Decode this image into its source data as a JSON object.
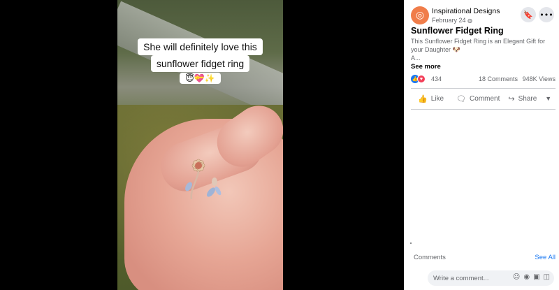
{
  "video": {
    "caption_line1": "She will definitely love this",
    "caption_line2": "sunflower fidget ring",
    "caption_emoji": "😇💝✨"
  },
  "post": {
    "page_name": "Inspirational Designs",
    "date": "February 24",
    "privacy_icon": "globe-icon",
    "title": "Sunflower Fidget Ring",
    "description": "This Sunflower Fidget Ring is an Elegant Gift for your Daughter 🐶",
    "description_tail": "A...",
    "see_more": "See more",
    "reactions_count": "434",
    "comments_count": "18 Comments",
    "views_count": "948K Views"
  },
  "actions": {
    "like": "Like",
    "comment": "Comment",
    "share": "Share"
  },
  "comments": {
    "label": "Comments",
    "see_all": "See All",
    "placeholder": "Write a comment..."
  },
  "colors": {
    "brand": "#1877f2",
    "avatar": "#f07d4a",
    "love": "#f33e58"
  }
}
